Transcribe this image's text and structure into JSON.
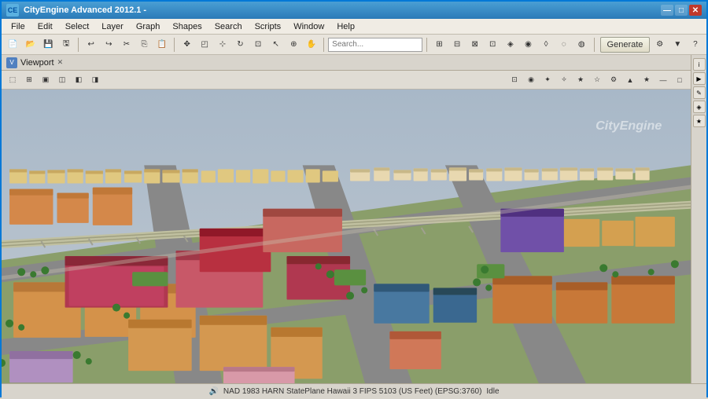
{
  "titleBar": {
    "title": "CityEngine Advanced 2012.1 -",
    "icon": "CE",
    "buttons": {
      "minimize": "—",
      "maximize": "□",
      "close": "✕"
    }
  },
  "menuBar": {
    "items": [
      {
        "label": "File",
        "id": "file"
      },
      {
        "label": "Edit",
        "id": "edit"
      },
      {
        "label": "Select",
        "id": "select"
      },
      {
        "label": "Layer",
        "id": "layer"
      },
      {
        "label": "Graph",
        "id": "graph"
      },
      {
        "label": "Shapes",
        "id": "shapes"
      },
      {
        "label": "Search",
        "id": "search"
      },
      {
        "label": "Scripts",
        "id": "scripts"
      },
      {
        "label": "Window",
        "id": "window"
      },
      {
        "label": "Help",
        "id": "help"
      }
    ]
  },
  "toolbar": {
    "generateLabel": "Generate",
    "searchPlaceholder": ""
  },
  "viewport": {
    "title": "Viewport",
    "watermark": "CityEngine"
  },
  "statusBar": {
    "text": "NAD 1983 HARN StatePlane Hawaii 3 FIPS 5103 (US Feet) (EPSG:3760)",
    "status": "Idle"
  }
}
